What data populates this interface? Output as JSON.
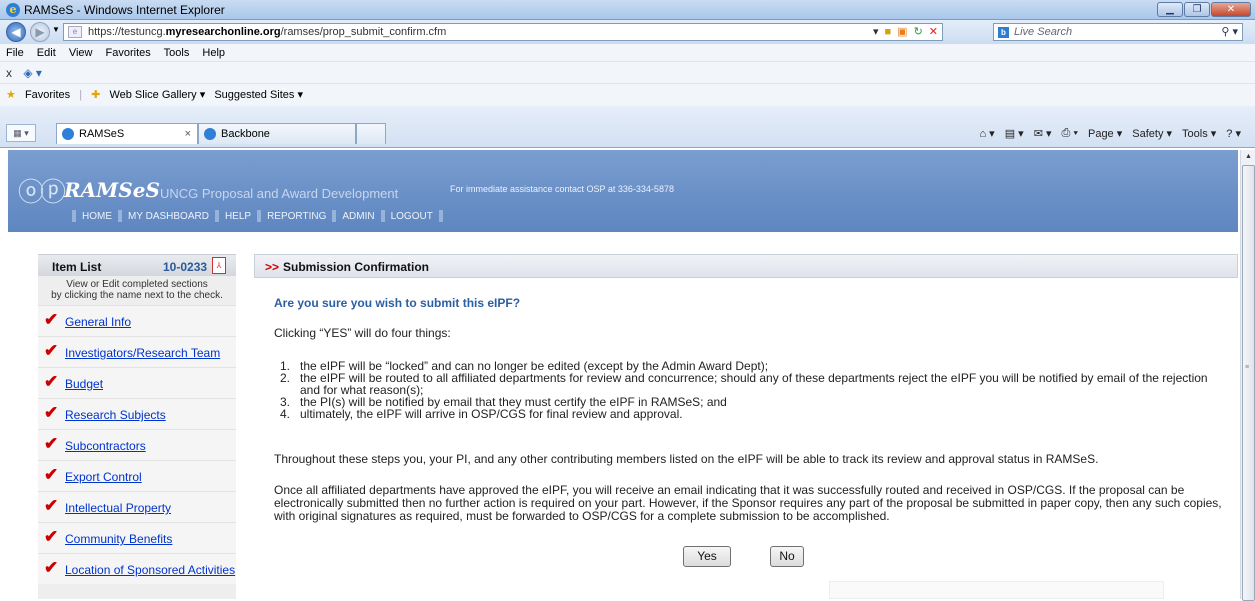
{
  "window": {
    "title": "RAMSeS - Windows Internet Explorer"
  },
  "address": {
    "url_prefix": "https://testuncg.",
    "url_domain": "myresearchonline.org",
    "url_path": "/ramses/prop_submit_confirm.cfm"
  },
  "search": {
    "placeholder": "Live Search"
  },
  "menu": [
    "File",
    "Edit",
    "View",
    "Favorites",
    "Tools",
    "Help"
  ],
  "favorites": {
    "label": "Favorites",
    "items": [
      "Web Slice Gallery ▾",
      "Suggested Sites ▾"
    ]
  },
  "tabs": [
    {
      "label": "RAMSeS"
    },
    {
      "label": "Backbone"
    }
  ],
  "commandbar": [
    "Page ▾",
    "Safety ▾",
    "Tools ▾"
  ],
  "banner": {
    "logo_text": "RAMSeS",
    "logo_sub": "UNCG Proposal and Award Development",
    "assist": "For immediate assistance contact OSP at 336-334-5878",
    "nav": [
      "HOME",
      "MY DASHBOARD",
      "HELP",
      "REPORTING",
      "ADMIN",
      "LOGOUT"
    ]
  },
  "sidebar": {
    "title": "Item List",
    "number": "10-0233",
    "help_line1": "View or Edit completed sections",
    "help_line2": "by clicking the name next to the check.",
    "items": [
      "General Info",
      "Investigators/Research Team",
      "Budget",
      "Research Subjects",
      "Subcontractors",
      "Export Control",
      "Intellectual Property",
      "Community Benefits",
      "Location of Sponsored Activities"
    ]
  },
  "main": {
    "header_arrows": ">>",
    "header_title": "Submission Confirmation",
    "question": "Are you sure you wish to submit this eIPF?",
    "intro": "Clicking “YES” will do four things:",
    "steps": [
      {
        "n": "1.",
        "text": "the eIPF will be “locked” and can no longer be edited (except by the Admin Award Dept);"
      },
      {
        "n": "2.",
        "text": "the eIPF will be routed to all affiliated departments for review and concurrence; should any of these departments reject the eIPF you will be notified by email of the rejection and for what reason(s);"
      },
      {
        "n": "3.",
        "text": "the PI(s) will be notified by email that they must certify the eIPF in RAMSeS; and"
      },
      {
        "n": "4.",
        "text": "ultimately, the eIPF will arrive in OSP/CGS for final review and approval."
      }
    ],
    "para1": "Throughout these steps you, your PI, and any other contributing members listed on the eIPF will be able to track its review and approval status in RAMSeS.",
    "para2": "Once all affiliated departments have approved the eIPF, you will receive an email indicating that it was successfully routed and received in OSP/CGS. If the proposal can be electronically submitted then no further action is required on your part. However, if the Sponsor requires any part of the proposal be submitted in paper copy, then any such copies, with original signatures as required, must be forwarded to OSP/CGS for a complete submission to be accomplished.",
    "yes_label": "Yes",
    "no_label": "No"
  }
}
